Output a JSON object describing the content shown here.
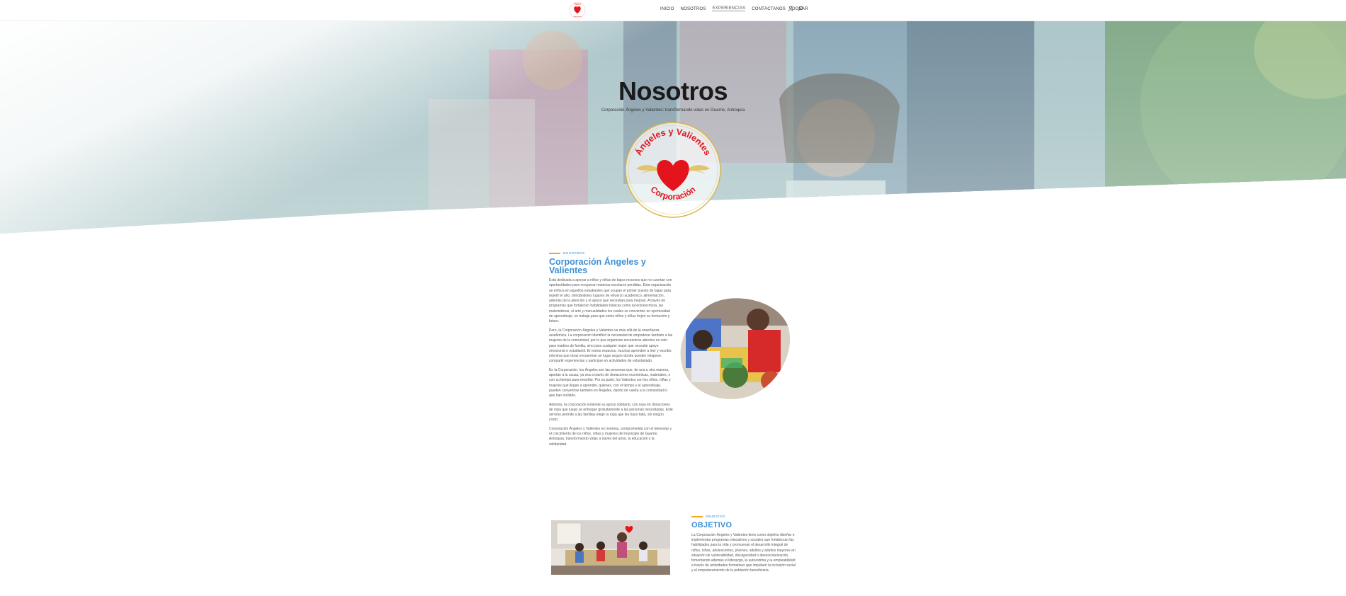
{
  "nav": {
    "items": [
      {
        "label": "INICIO",
        "active": false
      },
      {
        "label": "NOSOTROS",
        "active": false
      },
      {
        "label": "EXPERIENCIAS",
        "active": true
      },
      {
        "label": "CONTÁCTANOS",
        "active": false
      },
      {
        "label": "DONAR",
        "active": false
      }
    ],
    "icons": [
      "user-icon",
      "search-icon"
    ]
  },
  "hero": {
    "title": "Nosotros",
    "subtitle": "Corporación Ángeles y Valientes: transformando vidas en Guarne, Antioquia"
  },
  "emblem": {
    "top_text": "Ángeles y Valientes",
    "bottom_text": "Corporación"
  },
  "section_about": {
    "eyebrow": "NOSOTROS",
    "title": "Corporación Ángeles y Valientes",
    "paragraphs": [
      "Está dedicada a apoyar a niños y niñas de bajos recursos que no cuentan con oportunidades para recuperar materias escolares perdidas. Esta organización se enfoca en aquellos estudiantes que ocupan el primer puesto de bajas para repetir el año, brindándoles lugares de refuerzo académico, alimentación, además de la atención y el apoyo que necesitan para mejorar. A través de programas que fortalecen habilidades básicas como la lectoescritura, las matemáticas, el arte y manualidades los cuales se convierten en oportunidad de aprendizaje, se trabaja para que estos niños y niñas forjen su formación y futuro.",
      "Pero, la Corporación Ángeles y Valientes va más allá de la enseñanza académica. La corporación identificó la necesidad de empoderar también a las mujeres de la comunidad, por lo que organizan encuentros abiertos no solo para madres de familia, sino para cualquier mujer que necesite apoyo emocional o estudiantil. En estos espacios, muchas aprenden a leer y escribir, mientras que otras encuentran un lugar seguro donde pueden relajarse, compartir experiencias y participar en actividades de voluntariado.",
      "En la Corporación, los Ángeles son las personas que, de una u otra manera, aportan a la causa, ya sea a través de donaciones económicas, materiales, o con su tiempo para enseñar. Por su parte, los Valientes son los niños, niñas y mujeres que llegan a aprender, quienes, con el tiempo y el aprendizaje, pueden convertirse también en Ángeles, dando de vuelta a la comunidad lo que han recibido.",
      "Además, la corporación extiende su apoyo solidario, con ropa en donaciones de ropa que luego se entregan gratuitamente a las personas necesitadas. Este servicio permite a las familias elegir la ropa que les hace falta, sin ningún costo.",
      "Corporación Ángeles y Valientes es honesta, comprometida con el bienestar y el crecimiento de los niños, niñas y mujeres del municipio de Guarne, Antioquia, transformando vidas a través del amor, la educación y la solidaridad."
    ]
  },
  "section_objective": {
    "eyebrow": "OBJETIVO",
    "title": "OBJETIVO",
    "paragraph": "La Corporación Ángeles y Valientes tiene como objetivo diseñar e implementar programas educativos y sociales que fortalezcan las habilidades para la vida y promuevan el desarrollo integral de niños, niñas, adolescentes, jóvenes, adultos y adultos mayores en situación de vulnerabilidad, discapacidad o desescolarización, fomentando además el liderazgo, la autoestima y la empleabilidad a través de actividades formativas que impulsen la inclusión social y el empoderamiento de la población beneficiaria."
  },
  "colors": {
    "accent_blue": "#3d8fd6",
    "accent_orange": "#f5a623",
    "emblem_red": "#e3141b",
    "emblem_gold": "#d9b24c"
  }
}
